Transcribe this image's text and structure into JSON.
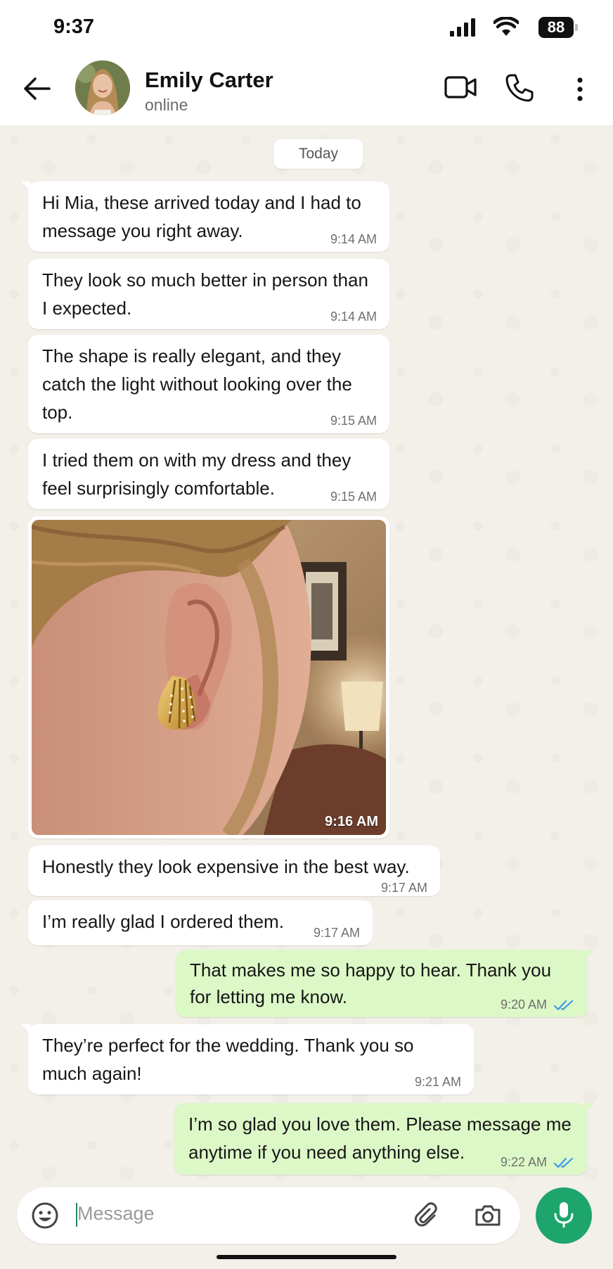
{
  "status_bar": {
    "time": "9:37",
    "battery": "88"
  },
  "header": {
    "contact_name": "Emily Carter",
    "presence": "online"
  },
  "chat": {
    "date_chip": "Today",
    "messages": [
      {
        "dir": "in",
        "text": "Hi Mia, these arrived today and I had to message you right away.",
        "time": "9:14 AM"
      },
      {
        "dir": "in",
        "text": "They look so much better in person than I expected.",
        "time": "9:14 AM"
      },
      {
        "dir": "in",
        "text": "The shape is really elegant, and they catch the light without looking over the top.",
        "time": "9:15 AM"
      },
      {
        "dir": "in",
        "text": "I tried them on with my dress and they feel surprisingly comfortable.",
        "time": "9:15 AM"
      },
      {
        "dir": "in",
        "text": "Honestly they look expensive in the best way.",
        "time": "9:17 AM"
      },
      {
        "dir": "in",
        "text": "I’m really glad I ordered them.",
        "time": "9:17 AM"
      },
      {
        "dir": "out",
        "text": "That makes me so happy to hear. Thank you for letting me know.",
        "time": "9:20 AM",
        "status": "read"
      },
      {
        "dir": "in",
        "text": "They’re perfect for the wedding. Thank you so much again!",
        "time": "9:21 AM"
      },
      {
        "dir": "out",
        "text": "I’m so glad you love them. Please message me anytime if you need anything else.",
        "time": "9:22 AM",
        "status": "read"
      }
    ],
    "photo": {
      "time": "9:16 AM",
      "subject": "ear with gold shell earring"
    }
  },
  "composer": {
    "placeholder": "Message"
  },
  "icons": {
    "back": "arrow-left-icon",
    "video": "video-call-icon",
    "voice": "phone-icon",
    "menu": "more-vertical-icon",
    "emoji": "emoji-icon",
    "attach": "paperclip-icon",
    "camera": "camera-icon",
    "mic": "microphone-icon"
  },
  "colors": {
    "incoming": "#ffffff",
    "outgoing": "#dcf8c7",
    "accent": "#1da56d",
    "read_ticks": "#3a9be8",
    "background": "#f3efe9"
  }
}
